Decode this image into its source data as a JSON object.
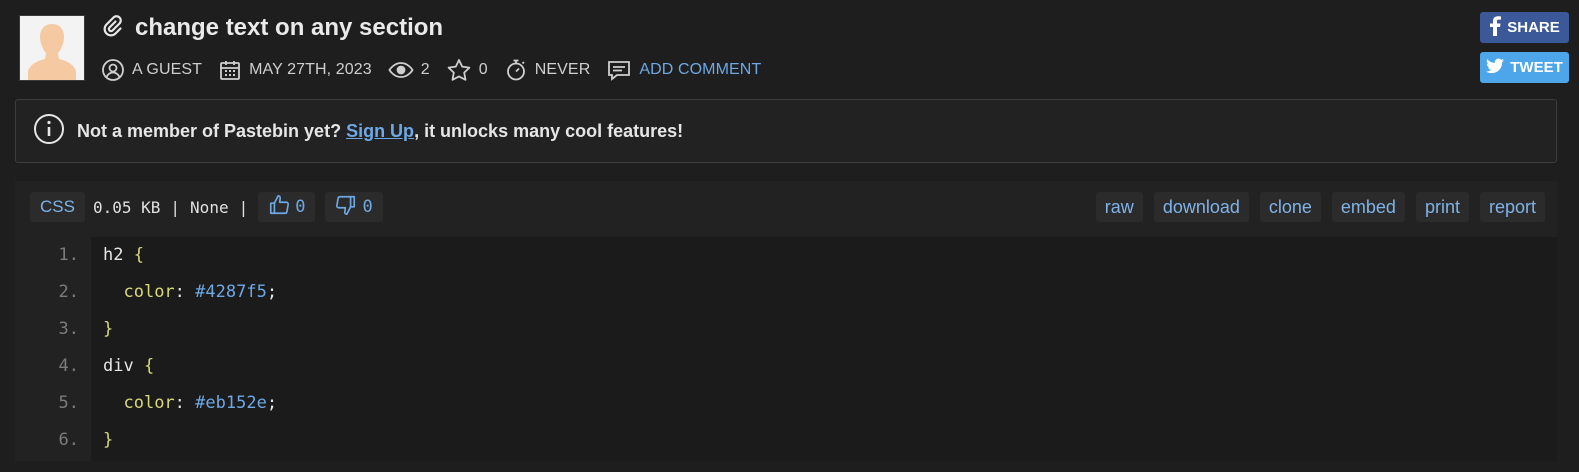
{
  "paste": {
    "title": "change text on any section",
    "author": "A GUEST",
    "date": "MAY 27TH, 2023",
    "views": "2",
    "stars": "0",
    "expiry": "NEVER",
    "add_comment": "ADD COMMENT"
  },
  "social": {
    "share_label": "SHARE",
    "tweet_label": "TWEET"
  },
  "notice": {
    "prefix": "Not a member of Pastebin yet? ",
    "signup": "Sign Up",
    "suffix": ", it unlocks many cool features!"
  },
  "toolbar": {
    "language": "CSS",
    "size": "0.05 KB",
    "separator": "|",
    "category": "None",
    "likes": "0",
    "dislikes": "0",
    "actions": [
      "raw",
      "download",
      "clone",
      "embed",
      "print",
      "report"
    ]
  },
  "code": {
    "lines": [
      {
        "num": "1.",
        "selector": "h2 ",
        "open": "{"
      },
      {
        "num": "2.",
        "prop": "color",
        "colon": ": ",
        "value": "#4287f5",
        "end": ";"
      },
      {
        "num": "3.",
        "close": "}"
      },
      {
        "num": "4.",
        "selector": "div ",
        "open": "{"
      },
      {
        "num": "5.",
        "prop": "color",
        "colon": ": ",
        "value": "#eb152e",
        "end": ";"
      },
      {
        "num": "6.",
        "close": "}"
      }
    ]
  },
  "colors": {
    "background": "#1e1e1e",
    "link": "#6ea8e5",
    "facebook": "#3b5998",
    "twitter": "#4ca6e9"
  }
}
